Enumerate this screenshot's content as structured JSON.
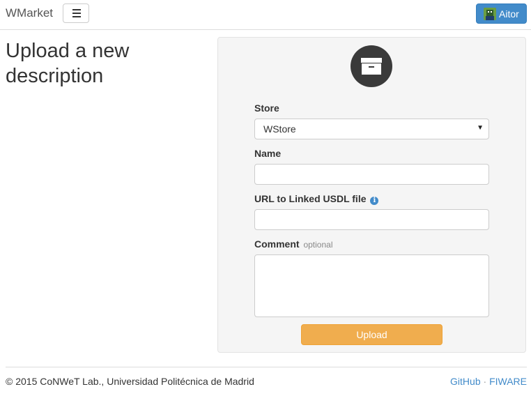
{
  "navbar": {
    "brand": "WMarket",
    "menu_icon": "hamburger-icon",
    "user": {
      "name": "Aitor",
      "avatar_icon": "user-avatar-icon"
    }
  },
  "page": {
    "title": "Upload a new description"
  },
  "form": {
    "header_icon": "archive-box-icon",
    "store_label": "Store",
    "store_value": "WStore",
    "name_label": "Name",
    "name_value": "",
    "url_label": "URL to Linked USDL file",
    "url_info_icon": "info-icon",
    "url_value": "",
    "comment_label": "Comment",
    "comment_hint": "optional",
    "comment_value": "",
    "upload_label": "Upload"
  },
  "footer": {
    "copyright": "© 2015 CoNWeT Lab., Universidad Politécnica de Madrid",
    "link_github": "GitHub",
    "separator": "·",
    "link_fiware": "FIWARE"
  },
  "colors": {
    "primary": "#428bca",
    "upload_button": "#f0ad4e",
    "panel_bg": "#f5f5f5",
    "icon_circle": "#3a3a3a"
  }
}
